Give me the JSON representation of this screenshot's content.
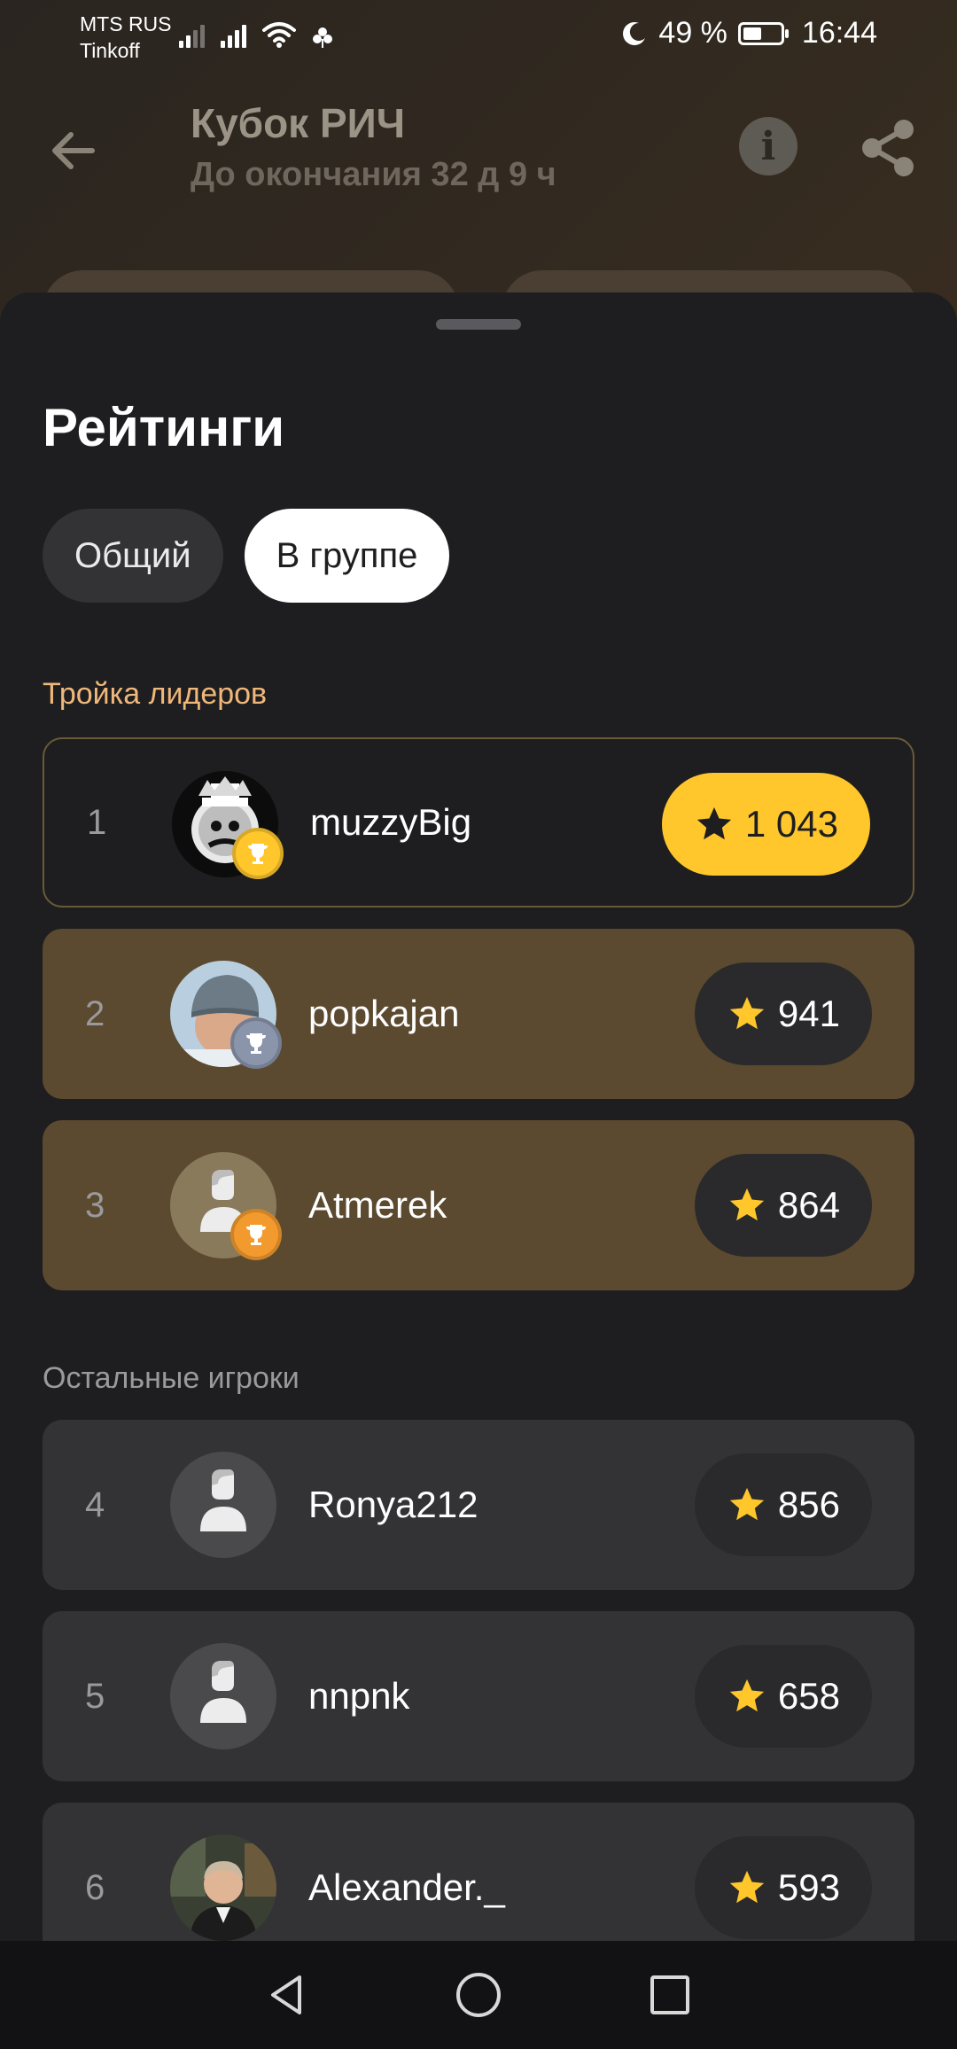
{
  "status_bar": {
    "carrier_1": "MTS RUS",
    "carrier_2": "Tinkoff",
    "battery": "49 %",
    "battery_level": 0.49,
    "time": "16:44",
    "icons": [
      "signal-icon",
      "signal-icon",
      "wifi-icon",
      "clover-icon",
      "moon-icon",
      "battery-icon"
    ]
  },
  "header": {
    "title": "Кубок РИЧ",
    "subtitle": "До окончания 32 д 9 ч",
    "icons": [
      "back-arrow-icon",
      "info-icon",
      "share-icon"
    ]
  },
  "sheet": {
    "title": "Рейтинги",
    "tabs": [
      {
        "label": "Общий",
        "active": false
      },
      {
        "label": "В группе",
        "active": true
      }
    ],
    "leaders_label": "Тройка лидеров",
    "others_label": "Остальные игроки",
    "leaders": [
      {
        "rank": "1",
        "name": "muzzyBig",
        "score": "1 043",
        "trophy": "gold",
        "avatar": "masked-hat"
      },
      {
        "rank": "2",
        "name": "popkajan",
        "score": "941",
        "trophy": "silver",
        "avatar": "winter-hat"
      },
      {
        "rank": "3",
        "name": "Atmerek",
        "score": "864",
        "trophy": "bronze",
        "avatar": "default"
      }
    ],
    "others": [
      {
        "rank": "4",
        "name": "Ronya212",
        "score": "856",
        "avatar": "default"
      },
      {
        "rank": "5",
        "name": "nnpnk",
        "score": "658",
        "avatar": "default"
      },
      {
        "rank": "6",
        "name": "Alexander._",
        "score": "593",
        "avatar": "photo-man"
      }
    ]
  },
  "colors": {
    "gold": "#ffc72c",
    "silver": "#8a95ab",
    "bronze": "#f29a2e",
    "leaders_label": "#f0b77a",
    "others_label": "#9a9a9e",
    "sheet_bg": "#1e1e20"
  },
  "nav_bar": {
    "icons": [
      "back-triangle-icon",
      "home-circle-icon",
      "recents-square-icon"
    ]
  }
}
